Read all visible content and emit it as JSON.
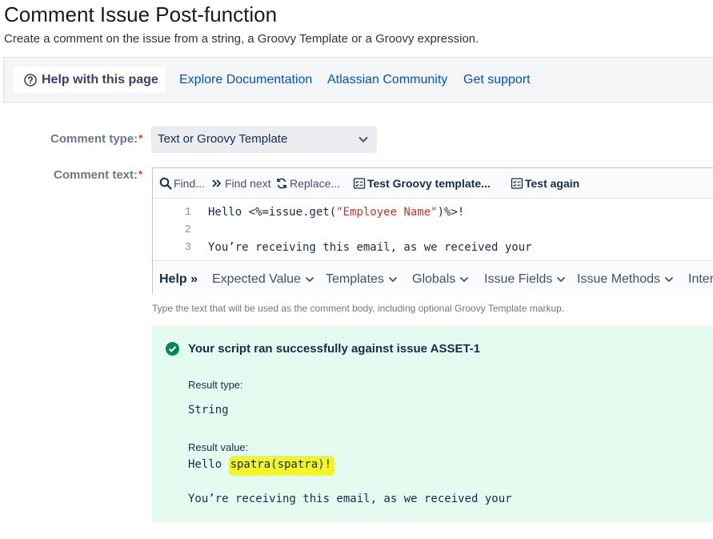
{
  "page": {
    "title": "Comment Issue Post-function",
    "subtitle": "Create a comment on the issue from a string, a Groovy Template or a Groovy expression."
  },
  "helpbar": {
    "help_button": "Help with this page",
    "links": [
      "Explore Documentation",
      "Atlassian Community",
      "Get support"
    ]
  },
  "form": {
    "comment_type_label": "Comment type:",
    "comment_type_value": "Text or Groovy Template",
    "comment_text_label": "Comment text:",
    "required_mark": "*",
    "hint": "Type the text that will be used as the comment body, including optional Groovy Template markup."
  },
  "editor": {
    "toolbar": {
      "find": "Find...",
      "find_next": "Find next",
      "replace": "Replace...",
      "test_template": "Test Groovy template...",
      "test_again": "Test again"
    },
    "lines": [
      {
        "num": "1",
        "pre": "Hello <%=issue.get(",
        "str": "\"Employee Name\"",
        "post": ")%>!"
      },
      {
        "num": "2",
        "pre": "",
        "str": "",
        "post": ""
      },
      {
        "num": "3",
        "pre": "You’re receiving this email, as we received your",
        "str": "",
        "post": ""
      }
    ],
    "help_strip": {
      "help_label": "Help",
      "arrows": "»",
      "items": [
        "Expected Value",
        "Templates",
        "Globals",
        "Issue Fields",
        "Issue Methods",
        "Inter"
      ]
    }
  },
  "result": {
    "message": "Your script ran successfully against issue ASSET-1",
    "type_label": "Result type:",
    "type_value": "String",
    "value_label": "Result value:",
    "value_prefix": "Hello ",
    "value_highlight": "spatra(spatra)!",
    "value_line3": "You’re receiving this email, as we received your",
    "highlight_color": "#f4f524"
  },
  "colors": {
    "link": "#0052cc",
    "success_bg": "#e3fcef",
    "success_icon": "#00875a",
    "required": "#de350b"
  }
}
